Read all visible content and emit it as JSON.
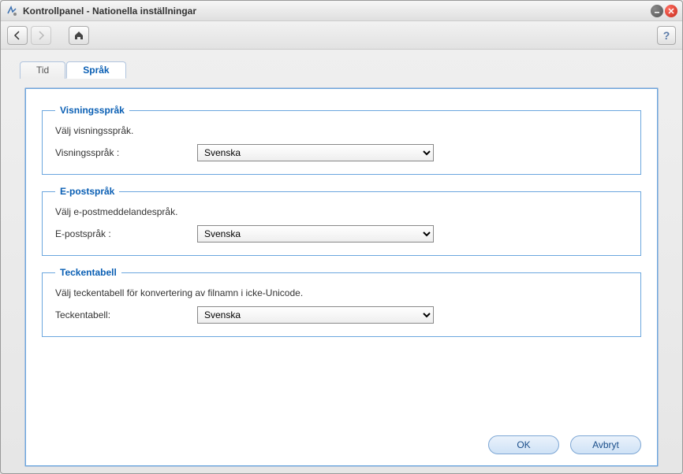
{
  "window": {
    "title": "Kontrollpanel - Nationella inställningar"
  },
  "toolbar": {
    "help_label": "?"
  },
  "tabs": [
    {
      "label": "Tid",
      "active": false
    },
    {
      "label": "Språk",
      "active": true
    }
  ],
  "sections": {
    "display": {
      "legend": "Visningsspråk",
      "desc": "Välj visningsspråk.",
      "label": "Visningsspråk :",
      "selected": "Svenska"
    },
    "email": {
      "legend": "E-postspråk",
      "desc": "Välj e-postmeddelandespråk.",
      "label": "E-postspråk :",
      "selected": "Svenska"
    },
    "codepage": {
      "legend": "Teckentabell",
      "desc": "Välj teckentabell för konvertering av filnamn i icke-Unicode.",
      "label": "Teckentabell:",
      "selected": "Svenska"
    }
  },
  "buttons": {
    "ok": "OK",
    "cancel": "Avbryt"
  }
}
